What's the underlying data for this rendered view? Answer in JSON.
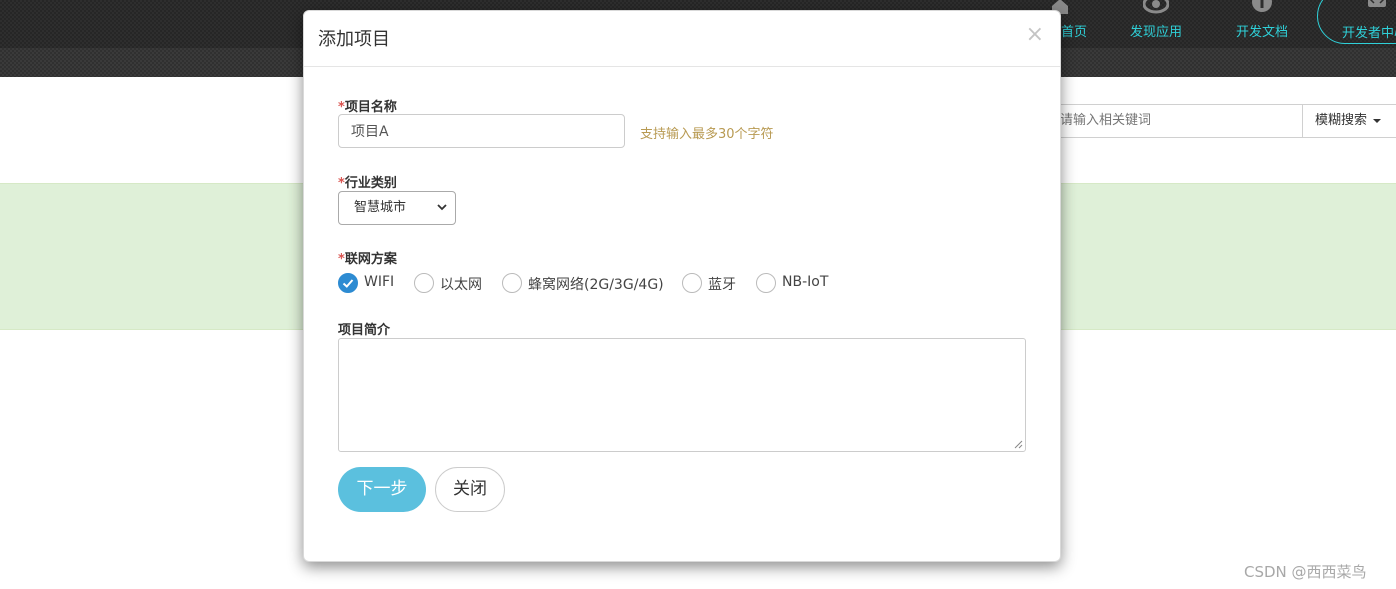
{
  "nav": {
    "home_label": "首页",
    "discover_label": "发现应用",
    "docs_label": "开发文档",
    "developer_label": "开发者中心"
  },
  "search": {
    "placeholder": "请输入相关键词",
    "mode_label": "模糊搜索"
  },
  "watermark": "CSDN @西西菜鸟",
  "colors": {
    "accent": "#5bc0de",
    "radio_checked": "#2d8bd2",
    "required": "#d9534f",
    "hint": "#b89a52",
    "nav_text": "#2fd0d8",
    "band": "#dff0d8"
  },
  "modal": {
    "title": "添加项目",
    "close_symbol": "×",
    "required_mark": "*",
    "project_name": {
      "label": "项目名称",
      "value": "项目A",
      "hint": "支持输入最多30个字符"
    },
    "industry": {
      "label": "行业类别",
      "selected": "智慧城市"
    },
    "network": {
      "label": "联网方案",
      "options": [
        {
          "label": "WIFI",
          "checked": true
        },
        {
          "label": "以太网",
          "checked": false
        },
        {
          "label": "蜂窝网络(2G/3G/4G)",
          "checked": false
        },
        {
          "label": "蓝牙",
          "checked": false
        },
        {
          "label": "NB-IoT",
          "checked": false
        }
      ]
    },
    "intro": {
      "label": "项目简介",
      "value": ""
    },
    "next_button": "下一步",
    "close_button": "关闭"
  }
}
